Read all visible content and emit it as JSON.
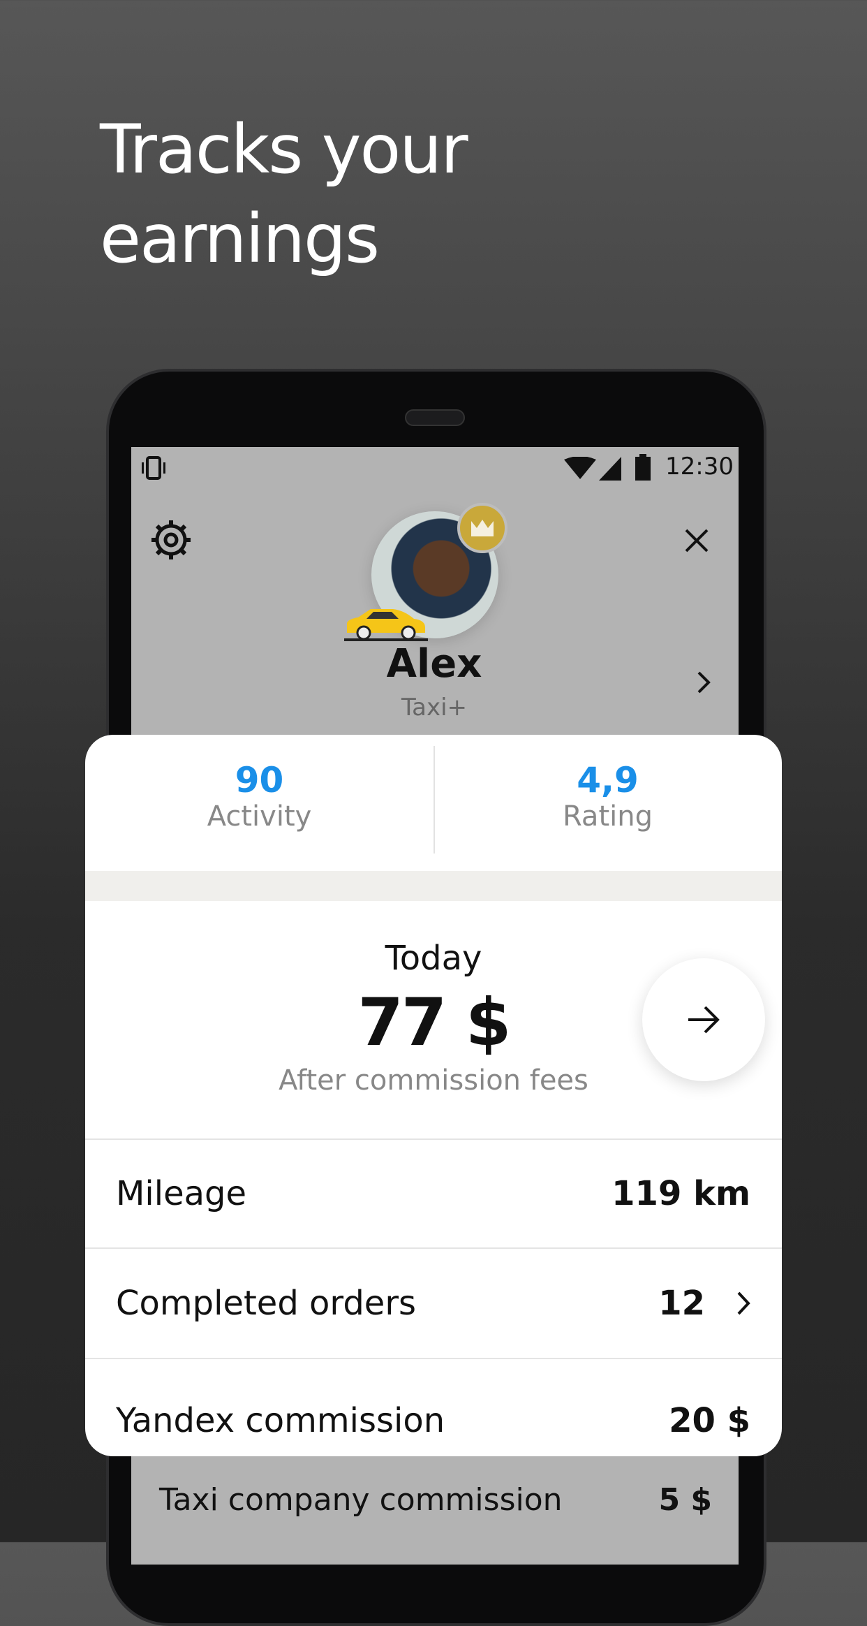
{
  "headline": [
    "Tracks your",
    "earnings"
  ],
  "status_bar": {
    "time": "12:30",
    "icons": [
      "vibrate-icon",
      "wifi-icon",
      "signal-icon",
      "battery-icon"
    ]
  },
  "profile": {
    "name": "Alex",
    "tariff": "Taxi+",
    "badge": "crown-icon"
  },
  "stats": [
    {
      "value": "90",
      "label": "Activity"
    },
    {
      "value": "4,9",
      "label": "Rating"
    }
  ],
  "today": {
    "title": "Today",
    "amount": "77 $",
    "note": "After commission fees"
  },
  "rows": [
    {
      "label": "Mileage",
      "value": "119 km"
    },
    {
      "label": "Completed orders",
      "value": "12"
    },
    {
      "label": "Yandex commission",
      "value": "20 $"
    }
  ],
  "below": {
    "label": "Taxi company commission",
    "value": "5 $"
  },
  "colors": {
    "accent": "#1a8fe8",
    "badge": "#c9a83a",
    "taxi": "#f5c518"
  }
}
